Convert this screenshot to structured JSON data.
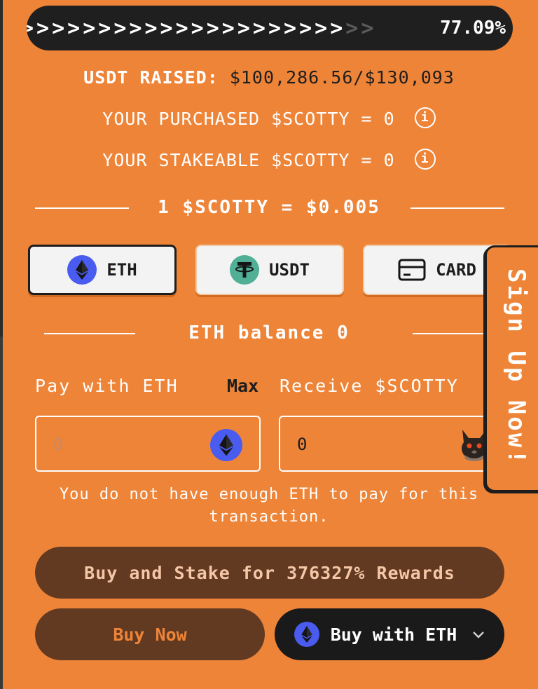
{
  "progress": {
    "percent_text": "77.09%",
    "fraction": 0.7709,
    "bright_chevrons": ">>>>>>>>>>>>>>>>>>>>>",
    "dim_chevrons": ">>"
  },
  "stats": {
    "raised_label": "USDT RAISED:",
    "raised_value": "$100,286.56/$130,093",
    "purchased": "YOUR PURCHASED $SCOTTY = 0",
    "stakeable": "YOUR STAKEABLE $SCOTTY = 0",
    "info_glyph": "i"
  },
  "rate": {
    "text": "1 $SCOTTY = $0.005"
  },
  "tokens": [
    {
      "label": "ETH",
      "icon": "eth-icon",
      "active": true
    },
    {
      "label": "USDT",
      "icon": "usdt-icon",
      "active": false
    },
    {
      "label": "CARD",
      "icon": "card-icon",
      "active": false
    }
  ],
  "balance": {
    "text": "ETH balance 0"
  },
  "form": {
    "pay_label": "Pay with ETH",
    "max_label": "Max",
    "receive_label": "Receive $SCOTTY",
    "pay_placeholder": "0",
    "receive_value": "0"
  },
  "warning": {
    "line1": "You do not have enough ETH to pay for this",
    "line2": "transaction."
  },
  "buttons": {
    "stake": "Buy and Stake for 376327% Rewards",
    "buy_now": "Buy Now",
    "buy_with": "Buy with ETH"
  },
  "signup": {
    "label": "Sign Up Now!"
  },
  "colors": {
    "background": "#ee8438",
    "dark": "#1d1d1d",
    "brown": "#623a22",
    "eth": "#4a5cf0",
    "usdt": "#50af95"
  }
}
